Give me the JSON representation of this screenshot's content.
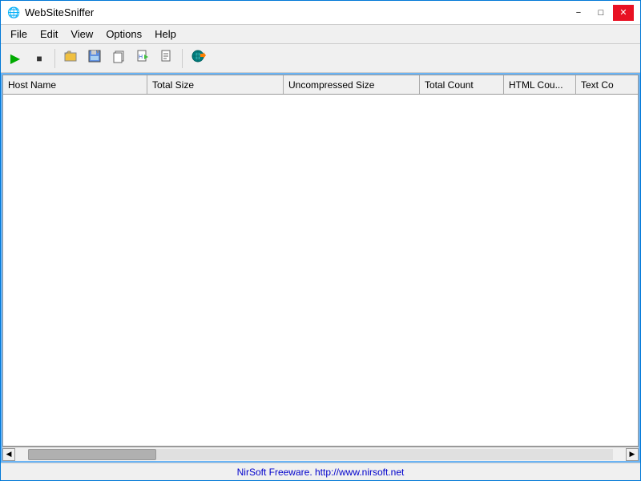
{
  "window": {
    "title": "WebSiteSniffer",
    "icon": "🌐"
  },
  "titlebar": {
    "minimize_label": "−",
    "restore_label": "□",
    "close_label": "✕"
  },
  "menu": {
    "items": [
      "File",
      "Edit",
      "View",
      "Options",
      "Help"
    ]
  },
  "toolbar": {
    "buttons": [
      {
        "name": "play",
        "icon": "▶",
        "label": "Start Capture"
      },
      {
        "name": "stop",
        "icon": "■",
        "label": "Stop Capture"
      },
      {
        "name": "separator1",
        "icon": "",
        "label": ""
      },
      {
        "name": "open",
        "icon": "📂",
        "label": "Open"
      },
      {
        "name": "save",
        "icon": "💾",
        "label": "Save"
      },
      {
        "name": "copy",
        "icon": "📋",
        "label": "Copy"
      },
      {
        "name": "export1",
        "icon": "📤",
        "label": "Export HTML"
      },
      {
        "name": "export2",
        "icon": "📄",
        "label": "Export Text"
      },
      {
        "name": "separator2",
        "icon": "",
        "label": ""
      },
      {
        "name": "properties",
        "icon": "🔧",
        "label": "Properties"
      }
    ]
  },
  "columns": [
    {
      "id": "host-name",
      "label": "Host Name"
    },
    {
      "id": "total-size",
      "label": "Total Size"
    },
    {
      "id": "uncompressed-size",
      "label": "Uncompressed Size"
    },
    {
      "id": "total-count",
      "label": "Total Count"
    },
    {
      "id": "html-count",
      "label": "HTML Cou..."
    },
    {
      "id": "text-count",
      "label": "Text Co"
    }
  ],
  "statusbar": {
    "text": "NirSoft Freeware.  http://www.nirsoft.net"
  }
}
